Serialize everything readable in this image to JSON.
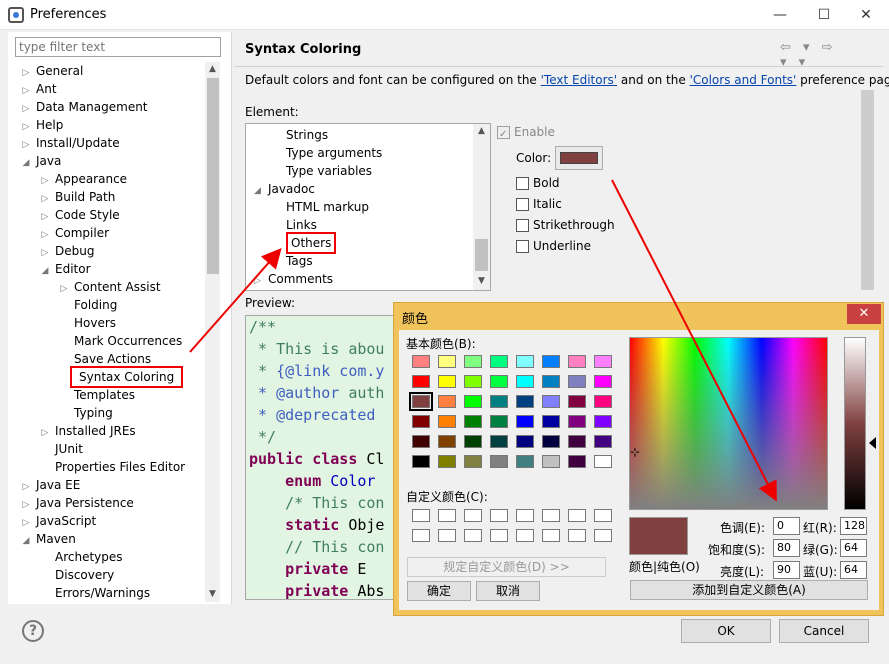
{
  "window": {
    "title": "Preferences",
    "controls": [
      "—",
      "☐",
      "✕"
    ]
  },
  "filter": {
    "placeholder": "type filter text"
  },
  "tree": [
    {
      "label": "General",
      "level": 0,
      "tw": "▷"
    },
    {
      "label": "Ant",
      "level": 0,
      "tw": "▷"
    },
    {
      "label": "Data Management",
      "level": 0,
      "tw": "▷"
    },
    {
      "label": "Help",
      "level": 0,
      "tw": "▷"
    },
    {
      "label": "Install/Update",
      "level": 0,
      "tw": "▷"
    },
    {
      "label": "Java",
      "level": 0,
      "tw": "◢"
    },
    {
      "label": "Appearance",
      "level": 1,
      "tw": "▷"
    },
    {
      "label": "Build Path",
      "level": 1,
      "tw": "▷"
    },
    {
      "label": "Code Style",
      "level": 1,
      "tw": "▷"
    },
    {
      "label": "Compiler",
      "level": 1,
      "tw": "▷"
    },
    {
      "label": "Debug",
      "level": 1,
      "tw": "▷"
    },
    {
      "label": "Editor",
      "level": 1,
      "tw": "◢"
    },
    {
      "label": "Content Assist",
      "level": 2,
      "tw": "▷"
    },
    {
      "label": "Folding",
      "level": 2,
      "tw": ""
    },
    {
      "label": "Hovers",
      "level": 2,
      "tw": ""
    },
    {
      "label": "Mark Occurrences",
      "level": 2,
      "tw": ""
    },
    {
      "label": "Save Actions",
      "level": 2,
      "tw": ""
    },
    {
      "label": "Syntax Coloring",
      "level": 2,
      "tw": "",
      "highlight": true
    },
    {
      "label": "Templates",
      "level": 2,
      "tw": ""
    },
    {
      "label": "Typing",
      "level": 2,
      "tw": ""
    },
    {
      "label": "Installed JREs",
      "level": 1,
      "tw": "▷"
    },
    {
      "label": "JUnit",
      "level": 1,
      "tw": ""
    },
    {
      "label": "Properties Files Editor",
      "level": 1,
      "tw": ""
    },
    {
      "label": "Java EE",
      "level": 0,
      "tw": "▷"
    },
    {
      "label": "Java Persistence",
      "level": 0,
      "tw": "▷"
    },
    {
      "label": "JavaScript",
      "level": 0,
      "tw": "▷"
    },
    {
      "label": "Maven",
      "level": 0,
      "tw": "◢"
    },
    {
      "label": "Archetypes",
      "level": 1,
      "tw": ""
    },
    {
      "label": "Discovery",
      "level": 1,
      "tw": ""
    },
    {
      "label": "Errors/Warnings",
      "level": 1,
      "tw": ""
    }
  ],
  "page": {
    "title": "Syntax Coloring",
    "nav_icons": "⇦ ▾ ⇨ ▾ ▾",
    "desc_pre": "Default colors and font can be configured on the ",
    "desc_link1": "'Text Editors'",
    "desc_mid": " and on the ",
    "desc_link2": "'Colors and Fonts'",
    "desc_post": " preference page.",
    "element_label": "Element:",
    "preview_label": "Preview:"
  },
  "elements": [
    {
      "label": "Strings",
      "indent": 2,
      "tw": ""
    },
    {
      "label": "Type arguments",
      "indent": 2,
      "tw": ""
    },
    {
      "label": "Type variables",
      "indent": 2,
      "tw": ""
    },
    {
      "label": "Javadoc",
      "indent": 1,
      "tw": "◢"
    },
    {
      "label": "HTML markup",
      "indent": 2,
      "tw": ""
    },
    {
      "label": "Links",
      "indent": 2,
      "tw": ""
    },
    {
      "label": "Others",
      "indent": 2,
      "tw": "",
      "highlight": true
    },
    {
      "label": "Tags",
      "indent": 2,
      "tw": ""
    },
    {
      "label": "Comments",
      "indent": 1,
      "tw": "▷"
    }
  ],
  "options": {
    "enable": "Enable",
    "color_label": "Color:",
    "color_value": "#804040",
    "bold": "Bold",
    "italic": "Italic",
    "strikethrough": "Strikethrough",
    "underline": "Underline"
  },
  "preview_lines": [
    [
      {
        "t": "/**",
        "c": "c-com"
      }
    ],
    [
      {
        "t": " * This is abou",
        "c": "c-com"
      }
    ],
    [
      {
        "t": " * ",
        "c": "c-com"
      },
      {
        "t": "{@link com.y",
        "c": "c-doc"
      }
    ],
    [
      {
        "t": " * @author ",
        "c": "c-doc"
      },
      {
        "t": "auth",
        "c": "c-com"
      }
    ],
    [
      {
        "t": " * @deprecated",
        "c": "c-doc"
      }
    ],
    [
      {
        "t": " */",
        "c": "c-com"
      }
    ],
    [
      {
        "t": "public class ",
        "c": "c-kw"
      },
      {
        "t": "Cl",
        "c": ""
      }
    ],
    [
      {
        "t": "    enum ",
        "c": "c-kw"
      },
      {
        "t": "Color",
        "c": "c-blue"
      }
    ],
    [
      {
        "t": "    /* This con",
        "c": "c-com"
      }
    ],
    [
      {
        "t": "    static ",
        "c": "c-kw"
      },
      {
        "t": "Obje",
        "c": ""
      }
    ],
    [
      {
        "t": "    // This con",
        "c": "c-com"
      }
    ],
    [
      {
        "t": "    private ",
        "c": "c-kw"
      },
      {
        "t": "E ",
        "c": ""
      }
    ],
    [
      {
        "t": "    private ",
        "c": "c-kw"
      },
      {
        "t": "Abs",
        "c": ""
      }
    ]
  ],
  "buttons": {
    "ok": "OK",
    "cancel": "Cancel",
    "help": "?"
  },
  "color_dialog": {
    "title": "颜色",
    "basic_label": "基本颜色(B):",
    "custom_label": "自定义颜色(C):",
    "define_custom": "规定自定义颜色(D) >>",
    "ok": "确定",
    "cancel": "取消",
    "solid_label": "颜色|纯色(O)",
    "hue_label": "色调(E):",
    "hue": "0",
    "sat_label": "饱和度(S):",
    "sat": "80",
    "lum_label": "亮度(L):",
    "lum": "90",
    "red_label": "红(R):",
    "red": "128",
    "green_label": "绿(G):",
    "green": "64",
    "blue_label": "蓝(U):",
    "blue": "64",
    "add_custom": "添加到自定义颜色(A)",
    "basic_colors": [
      "#ff8080",
      "#ffff80",
      "#80ff80",
      "#00ff80",
      "#80ffff",
      "#0080ff",
      "#ff80c0",
      "#ff80ff",
      "#ff0000",
      "#ffff00",
      "#80ff00",
      "#00ff40",
      "#00ffff",
      "#0080c0",
      "#8080c0",
      "#ff00ff",
      "#804040",
      "#ff8040",
      "#00ff00",
      "#008080",
      "#004080",
      "#8080ff",
      "#800040",
      "#ff0080",
      "#800000",
      "#ff8000",
      "#008000",
      "#008040",
      "#0000ff",
      "#0000a0",
      "#800080",
      "#8000ff",
      "#400000",
      "#804000",
      "#004000",
      "#004040",
      "#000080",
      "#000040",
      "#400040",
      "#400080",
      "#000000",
      "#808000",
      "#808040",
      "#808080",
      "#408080",
      "#c0c0c0",
      "#400040",
      "#ffffff"
    ],
    "selected_index": 16
  }
}
